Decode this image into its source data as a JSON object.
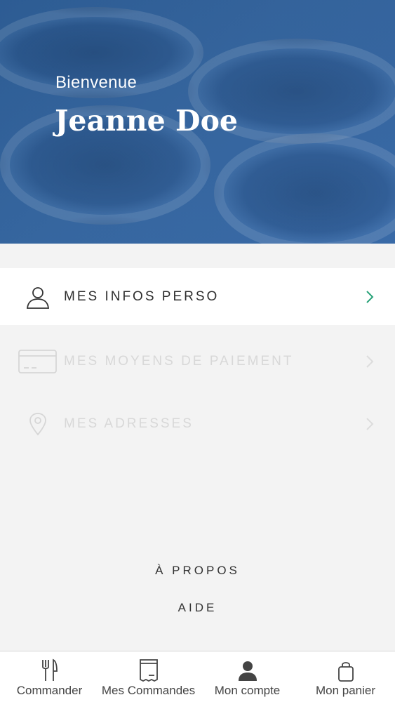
{
  "header": {
    "welcome": "Bienvenue",
    "user_name": "Jeanne Doe"
  },
  "menu": {
    "items": [
      {
        "label": "MES INFOS PERSO",
        "icon": "user-icon",
        "enabled": true
      },
      {
        "label": "MES MOYENS DE PAIEMENT",
        "icon": "credit-card-icon",
        "enabled": false
      },
      {
        "label": "MES ADRESSES",
        "icon": "location-pin-icon",
        "enabled": false
      }
    ]
  },
  "links": {
    "about": "À PROPOS",
    "help": "AIDE"
  },
  "tabbar": {
    "tabs": [
      {
        "label": "Commander",
        "icon": "fork-knife-icon"
      },
      {
        "label": "Mes Commandes",
        "icon": "receipt-icon"
      },
      {
        "label": "Mon compte",
        "icon": "person-icon"
      },
      {
        "label": "Mon panier",
        "icon": "bag-icon"
      }
    ]
  },
  "colors": {
    "header_blue": "#3767a0",
    "chevron_active": "#2aa37a",
    "disabled_text": "#d8d8d8"
  }
}
